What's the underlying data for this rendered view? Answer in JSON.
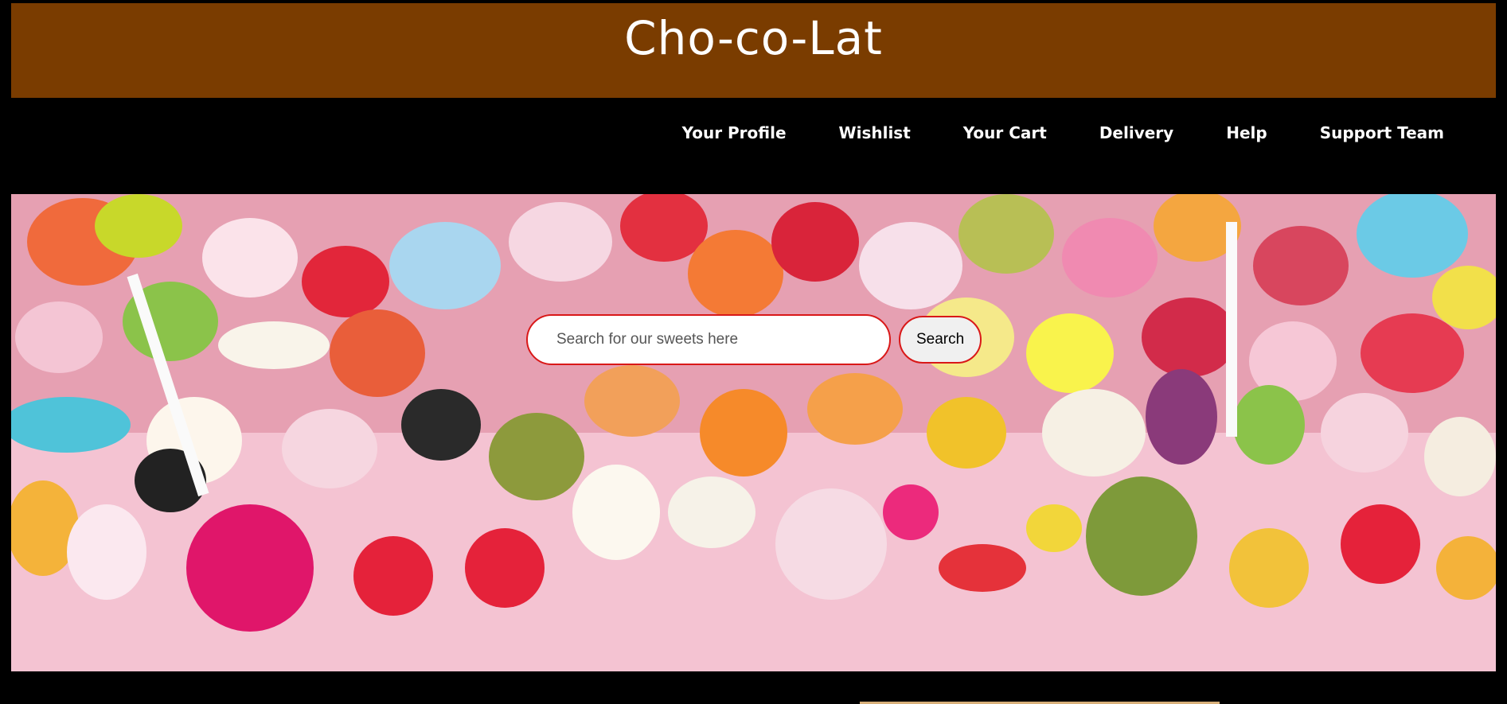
{
  "header": {
    "title": "Cho-co-Lat",
    "background": "#7a3c00"
  },
  "nav": {
    "items": [
      {
        "label": "Your Profile"
      },
      {
        "label": "Wishlist"
      },
      {
        "label": "Your Cart"
      },
      {
        "label": "Delivery"
      },
      {
        "label": "Help"
      },
      {
        "label": "Support Team"
      }
    ]
  },
  "hero": {
    "image_description": "candy-background",
    "search": {
      "placeholder": "Search for our sweets here",
      "button_label": "Search",
      "accent": "#d91818"
    }
  }
}
